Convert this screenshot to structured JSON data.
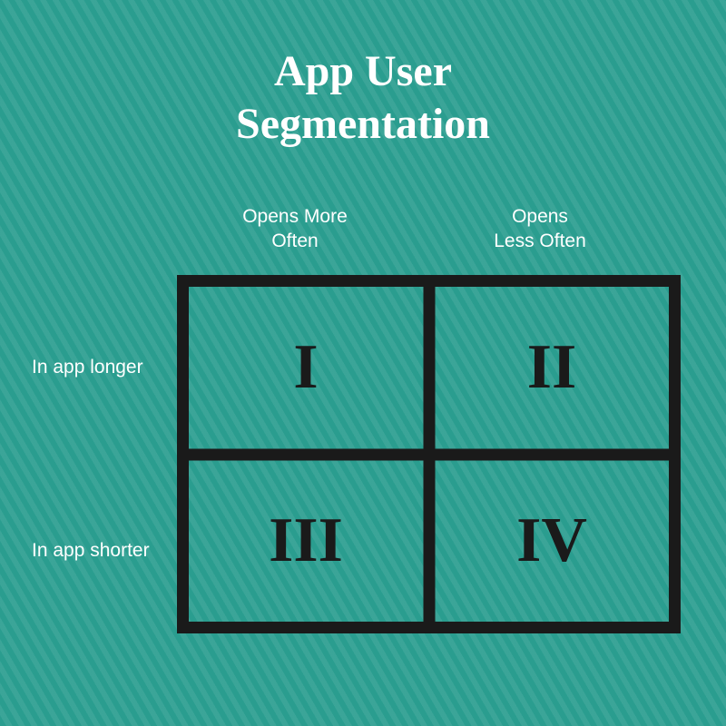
{
  "title": {
    "line1": "App User",
    "line2": "Segmentation"
  },
  "columns": {
    "header1_line1": "Opens More",
    "header1_line2": "Often",
    "header2_line1": "Opens",
    "header2_line2": "Less Often"
  },
  "rows": {
    "label1": "In app longer",
    "label2": "In app shorter"
  },
  "cells": {
    "q1": "I",
    "q2": "II",
    "q3": "III",
    "q4": "IV"
  },
  "chart_data": {
    "type": "table",
    "title": "App User Segmentation",
    "columns": [
      "Opens More Often",
      "Opens Less Often"
    ],
    "rows": [
      "In app longer",
      "In app shorter"
    ],
    "cells": [
      [
        "I",
        "II"
      ],
      [
        "III",
        "IV"
      ]
    ]
  }
}
